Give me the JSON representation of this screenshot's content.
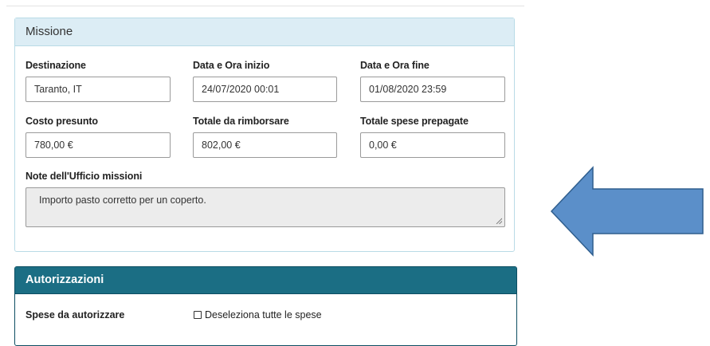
{
  "missione": {
    "title": "Missione",
    "fields": [
      {
        "label": "Destinazione",
        "value": "Taranto, IT"
      },
      {
        "label": "Data e Ora inizio",
        "value": "24/07/2020 00:01"
      },
      {
        "label": "Data e Ora fine",
        "value": "01/08/2020 23:59"
      },
      {
        "label": "Costo presunto",
        "value": "780,00 €"
      },
      {
        "label": "Totale da rimborsare",
        "value": "802,00 €"
      },
      {
        "label": "Totale spese prepagate",
        "value": "0,00 €"
      }
    ],
    "note_label": "Note dell'Ufficio missioni",
    "note_value": "Importo pasto corretto per un coperto."
  },
  "autorizzazioni": {
    "title": "Autorizzazioni",
    "spese_label": "Spese da autorizzare",
    "checkbox_label": "Deseleziona tutte le spese",
    "checkbox_checked": false
  },
  "colors": {
    "missione_header": "#dcedf5",
    "autorizzazioni_header": "#1b6e84",
    "arrow_fill": "#5b8fc9",
    "arrow_stroke": "#2f5e8e"
  },
  "annotation_arrow_icon": "left-arrow-icon"
}
